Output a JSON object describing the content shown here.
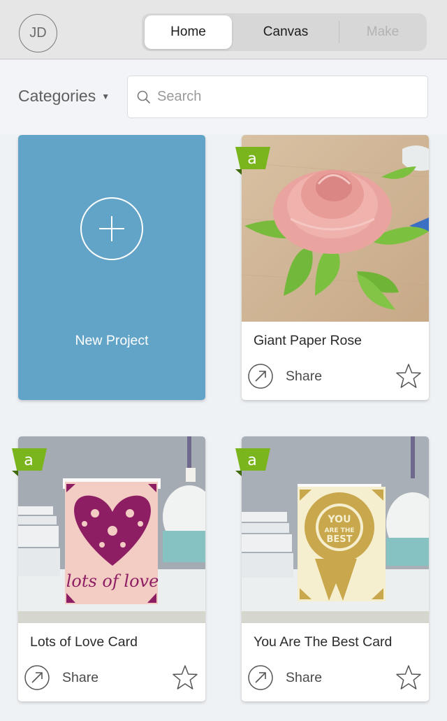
{
  "header": {
    "avatar_initials": "JD",
    "tabs": [
      {
        "label": "Home",
        "state": "active"
      },
      {
        "label": "Canvas",
        "state": "normal"
      },
      {
        "label": "Make",
        "state": "disabled"
      }
    ]
  },
  "filter": {
    "categories_label": "Categories",
    "search_placeholder": "Search",
    "search_value": ""
  },
  "new_project": {
    "label": "New Project",
    "icon": "plus-circle-icon"
  },
  "projects": [
    {
      "title": "Giant Paper Rose",
      "share_label": "Share",
      "badge": "access-badge",
      "favorited": false,
      "image": "paper-rose-photo"
    },
    {
      "title": "Lots of Love Card",
      "share_label": "Share",
      "badge": "access-badge",
      "favorited": false,
      "image": "lots-of-love-card-photo"
    },
    {
      "title": "You Are The Best Card",
      "share_label": "Share",
      "badge": "access-badge",
      "favorited": false,
      "image": "you-are-the-best-card-photo"
    }
  ],
  "colors": {
    "new_project_bg": "#62a3c8",
    "badge_green": "#7ab51d",
    "topbar_bg": "#e6e6e6",
    "page_bg": "#eff2f5"
  }
}
